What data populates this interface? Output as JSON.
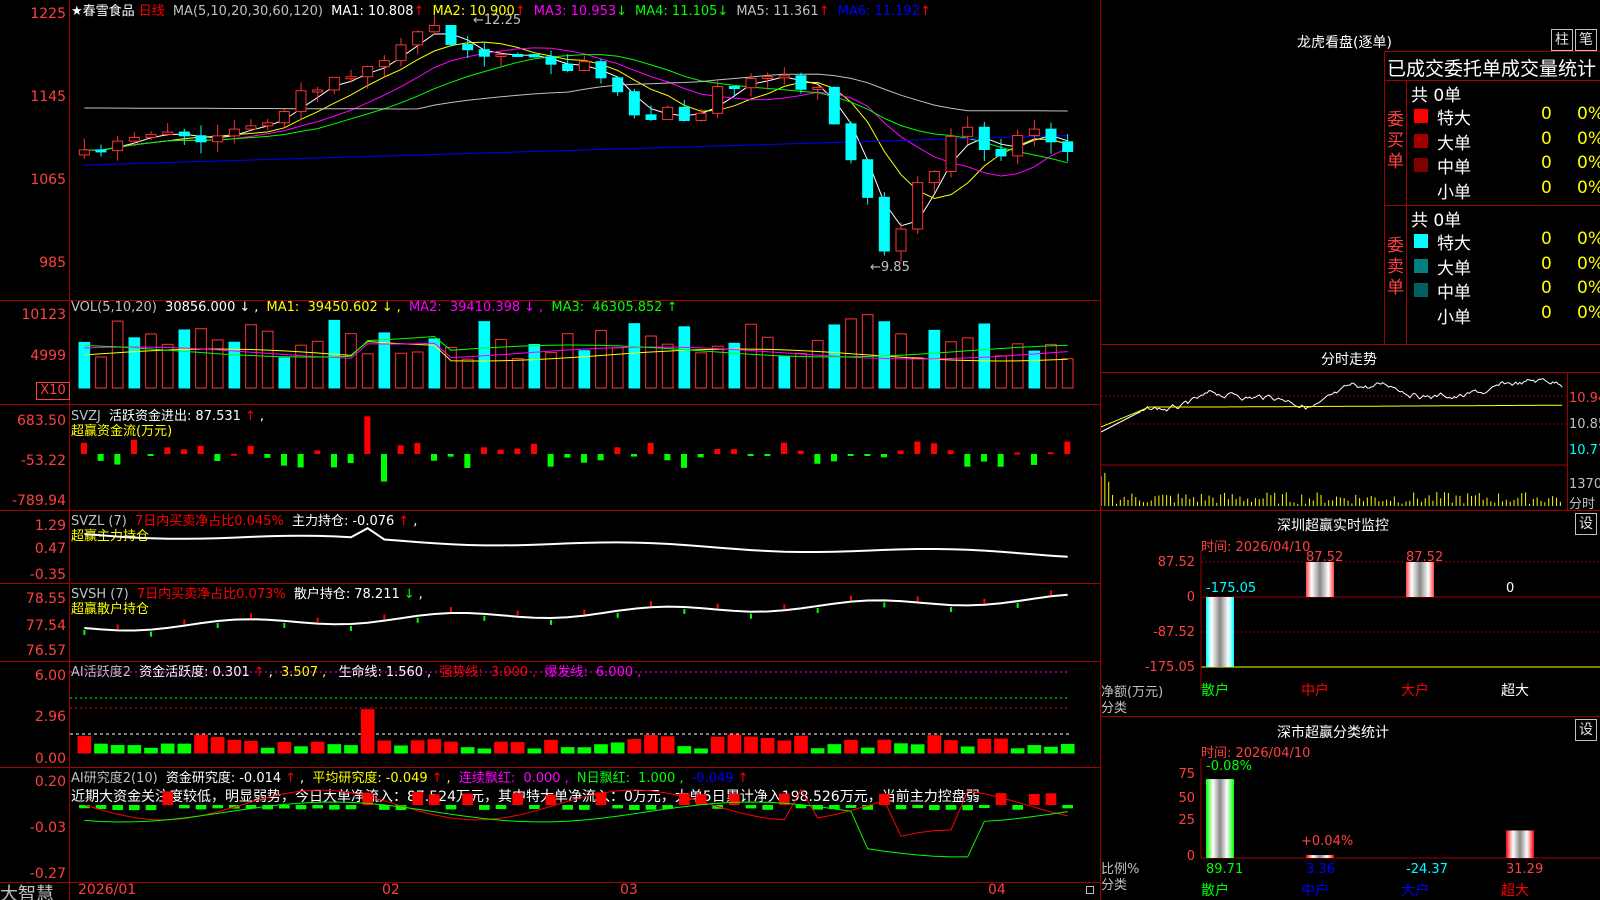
{
  "stock": {
    "star": "★",
    "name": "春雪食品",
    "period": "日线"
  },
  "ma_header": {
    "params": "MA(5,10,20,30,60,120)",
    "items": [
      {
        "label": "MA1:",
        "value": "10.808",
        "arrow": "↑",
        "color": "#ffffff"
      },
      {
        "label": "MA2:",
        "value": "10.900",
        "arrow": "↑",
        "color": "#ffff00"
      },
      {
        "label": "MA3:",
        "value": "10.953",
        "arrow": "↓",
        "color": "#ff00ff"
      },
      {
        "label": "MA4:",
        "value": "11.105",
        "arrow": "↓",
        "color": "#00ff00"
      },
      {
        "label": "MA5:",
        "value": "11.361",
        "arrow": "↑",
        "color": "#c0c0c0"
      },
      {
        "label": "MA6:",
        "value": "11.192",
        "arrow": "↑",
        "color": "#0000ff"
      }
    ]
  },
  "price_axis": [
    "1225",
    "1145",
    "1065",
    "985"
  ],
  "price_marks": {
    "high": "12.25",
    "low": "9.85"
  },
  "vol_header": {
    "label": "VOL(5,10,20)",
    "value": "30856.000",
    "arrow": "↓",
    "ma1": "MA1:",
    "ma1v": "39450.602",
    "ma1a": "↓",
    "ma2": "MA2:",
    "ma2v": "39410.398",
    "ma2a": "↓",
    "ma3": "MA3:",
    "ma3v": "46305.852",
    "ma3a": "↑"
  },
  "vol_axis": [
    "10123",
    "4999"
  ],
  "vol_unit": "X10",
  "svzj": {
    "name": "SVZJ",
    "label": "活跃资金进出:",
    "value": "87.531",
    "arrow": "↑",
    "sub": "超赢资金流(万元)",
    "axis": [
      "683.50",
      "-53.22",
      "-789.94"
    ]
  },
  "svzl": {
    "name": "SVZL (7)",
    "label": "7日内买卖净占比0.045%",
    "label2": "主力持仓:",
    "value": "-0.076",
    "arrow": "↑",
    "sub": "超赢主力持仓",
    "axis": [
      "1.29",
      "0.47",
      "-0.35"
    ]
  },
  "svsh": {
    "name": "SVSH (7)",
    "label": "7日内买卖净占比0.073%",
    "label2": "散户持仓:",
    "value": "78.211",
    "arrow": "↓",
    "sub": "超赢散户持仓",
    "axis": [
      "78.55",
      "77.54",
      "76.57"
    ]
  },
  "ai1": {
    "name": "AI活跃度2",
    "l1": "资金活跃度:",
    "v1": "0.301",
    "a1": "↑",
    "v2": "3.507",
    "a2": ",",
    "l3": "生命线:",
    "v3": "1.560",
    "l4": "强势线:",
    "v4": "3.000",
    "l5": "爆发线:",
    "v5": "6.000",
    "axis": [
      "6.00",
      "2.96",
      "0.00"
    ]
  },
  "ai2": {
    "name": "AI研究度2(10)",
    "l1": "资金研究度:",
    "v1": "-0.014",
    "a1": "↑",
    "l2": "平均研究度:",
    "v2": "-0.049",
    "a2": "↑",
    "l3": "连续飘红:",
    "v3": "0.000",
    "l4": "N日飘红:",
    "v4": "1.000",
    "v5": "-0.049",
    "a5": "↑",
    "summary": "近期大资金关注度较低，明显弱势，今日大单净流入：87.524万元，其中特大单净流入：0万元，大单5日累计净入198.526万元，当前主力控盘弱",
    "axis": [
      "0.20",
      "-0.03",
      "-0.27"
    ]
  },
  "date_axis": [
    "2026/01",
    "02",
    "03",
    "04"
  ],
  "brand": "大智慧",
  "right": {
    "lhb_title": "龙虎看盘(逐单)",
    "btn1": "柱",
    "btn2": "笔",
    "stats_title": "已成交委托单成交量统计",
    "buy_side": "委买单",
    "sell_side": "委卖单",
    "buy_total": "共 0单",
    "sell_total": "共 0单",
    "rows": [
      {
        "name": "特大",
        "num": "0",
        "pct": "0%"
      },
      {
        "name": "大单",
        "num": "0",
        "pct": "0%"
      },
      {
        "name": "中单",
        "num": "0",
        "pct": "0%"
      },
      {
        "name": "小单",
        "num": "0",
        "pct": "0%"
      }
    ],
    "colors": {
      "buy": [
        "#ff0000",
        "#a00000",
        "#800000",
        "#000000"
      ],
      "sell": [
        "#00ffff",
        "#008080",
        "#006060",
        "#000000"
      ]
    },
    "fs_title": "分时走势",
    "fs_axis": [
      "10.94",
      "10.85",
      "10.77",
      "1370",
      "分时"
    ],
    "sz_title": "深圳超赢实时监控",
    "sz_btn": "设",
    "sz_date": "时间: 2026/04/10",
    "sz_axis": [
      "87.52",
      "0",
      "-87.52",
      "-175.05"
    ],
    "sz_vals": [
      "-175.05",
      "87.52",
      "87.52",
      "0"
    ],
    "sz_ylabel": "净额(万元)",
    "fenlei": "分类",
    "cats": [
      "散户",
      "中户",
      "大户",
      "超大"
    ],
    "cl_title": "深市超赢分类统计",
    "cl_btn": "设",
    "cl_date": "时间: 2026/04/10",
    "cl_axis": [
      "75",
      "50",
      "25",
      "0"
    ],
    "cl_top": [
      "-0.08%",
      "+0.04%"
    ],
    "cl_bottom": [
      "89.71",
      "3.36",
      "-24.37",
      "31.29"
    ],
    "cl_ylabel": "比例%"
  }
}
